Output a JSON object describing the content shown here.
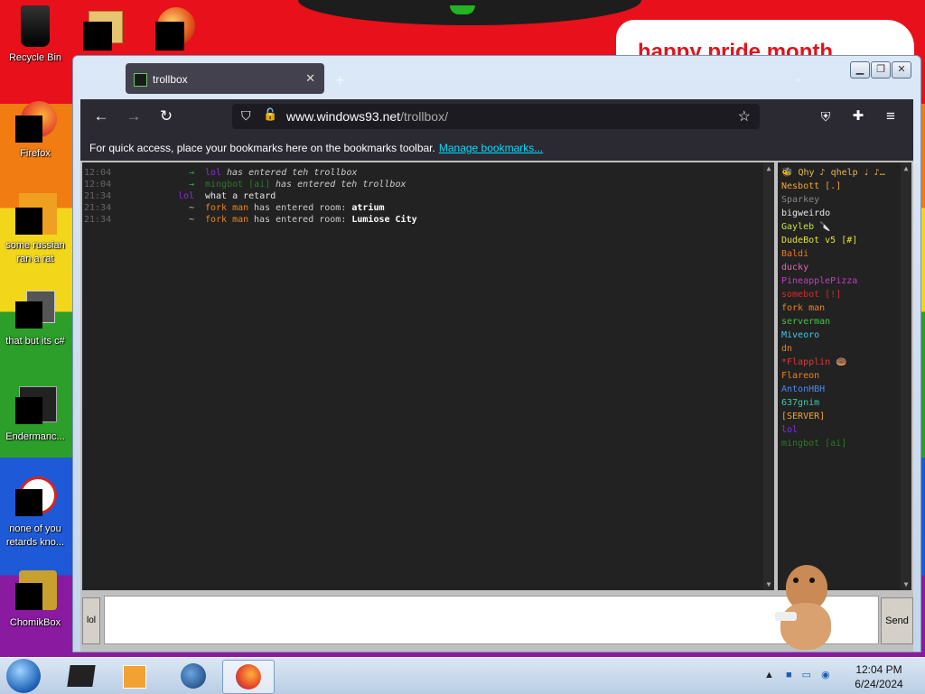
{
  "desktop": {
    "banner_text": "happy pride month",
    "icons": [
      {
        "label": "Recycle Bin",
        "icon": "recycle-bin-icon"
      },
      {
        "label": "Firefox",
        "icon": "firefox-icon"
      },
      {
        "label": "some russian ran a rat",
        "icon": "file-icon"
      },
      {
        "label": "that but its c#",
        "icon": "folder-icon"
      },
      {
        "label": "Endermanc...",
        "icon": "app-icon"
      },
      {
        "label": "none of you retards kno...",
        "icon": "app-icon"
      },
      {
        "label": "ChomikBox",
        "icon": "chomikbox-icon"
      }
    ]
  },
  "browser": {
    "tab_title": "trollbox",
    "tab_close": "✕",
    "new_tab": "+",
    "url_domain": "www.windows93.net",
    "url_path": "/trollbox/",
    "bookmarks_text": "For quick access, place your bookmarks here on the bookmarks toolbar.",
    "bookmarks_link": "Manage bookmarks..."
  },
  "trollbox": {
    "messages": [
      {
        "time": "12:04",
        "type": "join",
        "nick": "lol",
        "nick_color": "#8a2be2",
        "text": "has entered teh trollbox"
      },
      {
        "time": "12:04",
        "type": "join",
        "nick": "mingbot [ai]",
        "nick_color": "#2a7a2a",
        "text": "has entered teh trollbox"
      },
      {
        "time": "21:34",
        "type": "chat",
        "nick": "lol",
        "nick_color": "#8a2be2",
        "text": "what a retard"
      },
      {
        "time": "21:34",
        "type": "room",
        "nick": "fork man",
        "nick_color": "#e8851f",
        "text": "has entered room:",
        "room": "atrium"
      },
      {
        "time": "21:34",
        "type": "room",
        "nick": "fork man",
        "nick_color": "#e8851f",
        "text": "has entered room:",
        "room": "Lumiose City"
      }
    ],
    "users": [
      {
        "name": "🐝 Qhy ♪ qhelp ♩ ♪…",
        "color": "#e8b84a"
      },
      {
        "name": "Nesbott [.]",
        "color": "#f2a52e"
      },
      {
        "name": "Sparkey",
        "color": "#888888"
      },
      {
        "name": "bigweirdo",
        "color": "#e6e6e6"
      },
      {
        "name": "Gayleb 🔪",
        "color": "#c4e04a"
      },
      {
        "name": "DudeBot v5 [#]",
        "color": "#e3e33a"
      },
      {
        "name": "Baldi",
        "color": "#e87a2a"
      },
      {
        "name": "ducky",
        "color": "#d86ab0"
      },
      {
        "name": "PineapplePizza",
        "color": "#c040c0"
      },
      {
        "name": "somebot [!]",
        "color": "#d82a2a"
      },
      {
        "name": "fork man",
        "color": "#e8851f"
      },
      {
        "name": "serverman",
        "color": "#4ac04a"
      },
      {
        "name": "Miveoro",
        "color": "#40c8e8"
      },
      {
        "name": "dn",
        "color": "#e8851f"
      },
      {
        "name": "*Flapplin 🍩",
        "color": "#d83a3a"
      },
      {
        "name": "Flareon",
        "color": "#e8851f"
      },
      {
        "name": "AntonHBH",
        "color": "#4a8ae8"
      },
      {
        "name": "637gnim",
        "color": "#40c8a8"
      },
      {
        "name": "[SERVER]",
        "color": "#f2a52e"
      },
      {
        "name": "lol",
        "color": "#8a2be2"
      },
      {
        "name": "mingbot [ai]",
        "color": "#2a7a2a"
      }
    ],
    "nick_button": "lol",
    "send_button": "Send",
    "input_value": ""
  },
  "taskbar": {
    "clock_time": "12:04 PM",
    "clock_date": "6/24/2024"
  }
}
